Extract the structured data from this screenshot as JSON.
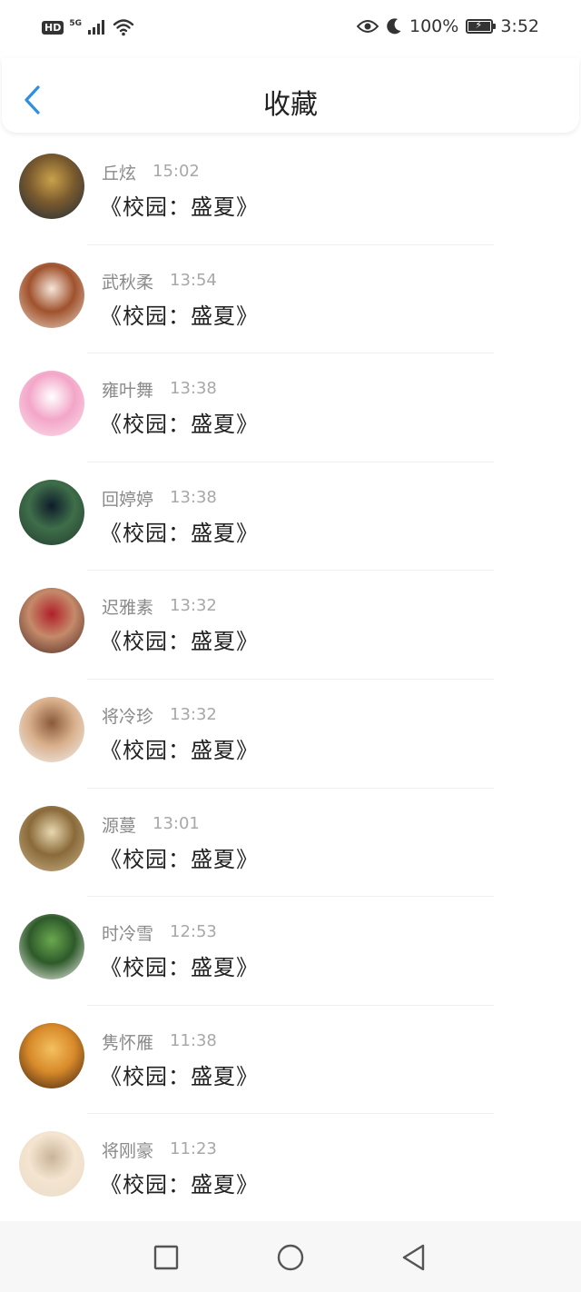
{
  "status_bar": {
    "hd": "HD",
    "network": "5G",
    "battery_percent": "100%",
    "time": "3:52"
  },
  "header": {
    "title": "收藏",
    "back_icon": "chevron-left-icon"
  },
  "items": [
    {
      "name": "丘炫",
      "time": "15:02",
      "title": "《校园：盛夏》",
      "avatar_colors": [
        "#1b2a3a",
        "#7a5a2e",
        "#c9a24a"
      ]
    },
    {
      "name": "武秋柔",
      "time": "13:54",
      "title": "《校园：盛夏》",
      "avatar_colors": [
        "#e9d4c4",
        "#a0522d",
        "#f5e6da"
      ]
    },
    {
      "name": "雍叶舞",
      "time": "13:38",
      "title": "《校园：盛夏》",
      "avatar_colors": [
        "#fbe3ee",
        "#f3a6c8",
        "#ffffff"
      ]
    },
    {
      "name": "回婷婷",
      "time": "13:38",
      "title": "《校园：盛夏》",
      "avatar_colors": [
        "#1f3a2b",
        "#3f6e4a",
        "#0e1c2a"
      ]
    },
    {
      "name": "迟雅素",
      "time": "13:32",
      "title": "《校园：盛夏》",
      "avatar_colors": [
        "#4a2a22",
        "#c58a6a",
        "#b0202a"
      ]
    },
    {
      "name": "将冷珍",
      "time": "13:32",
      "title": "《校园：盛夏》",
      "avatar_colors": [
        "#f2f2f2",
        "#d9b08c",
        "#8a5a3a"
      ]
    },
    {
      "name": "源蔓",
      "time": "13:01",
      "title": "《校园：盛夏》",
      "avatar_colors": [
        "#c9b48a",
        "#8a6a3a",
        "#e8d8b0"
      ]
    },
    {
      "name": "时冷雪",
      "time": "12:53",
      "title": "《校园：盛夏》",
      "avatar_colors": [
        "#f5f5f0",
        "#2e5a2a",
        "#6aa84f"
      ]
    },
    {
      "name": "隽怀雁",
      "time": "11:38",
      "title": "《校园：盛夏》",
      "avatar_colors": [
        "#3a1e10",
        "#d88a2a",
        "#f4c060"
      ]
    },
    {
      "name": "将刚豪",
      "time": "11:23",
      "title": "《校园：盛夏》",
      "avatar_colors": [
        "#e8dcc8",
        "#f4e4d0",
        "#c8b498"
      ]
    }
  ],
  "nav": {
    "recent_icon": "square-icon",
    "home_icon": "circle-icon",
    "back_icon": "triangle-back-icon"
  },
  "colors": {
    "accent": "#2f8fe0",
    "name_text": "#8a8a8a",
    "time_text": "#a8a8a8",
    "title_text": "#222222"
  }
}
